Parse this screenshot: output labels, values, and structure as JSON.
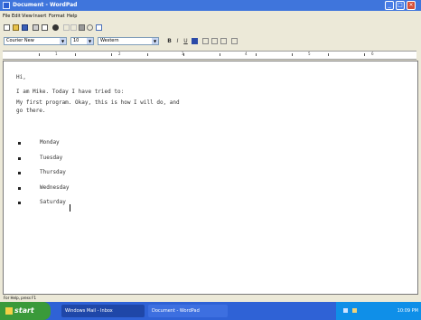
{
  "window": {
    "title": "Document - WordPad",
    "controls": {
      "minimize": "_",
      "maximize": "□",
      "close": "×"
    }
  },
  "menu": [
    "File",
    "Edit",
    "View",
    "Insert",
    "Format",
    "Help"
  ],
  "format_bar": {
    "font_name": "Courier New",
    "font_size": "10",
    "script": "Western",
    "bold": "B",
    "italic": "I",
    "underline": "U"
  },
  "ruler": [
    "1",
    "2",
    "3",
    "4",
    "5",
    "6"
  ],
  "document": {
    "lines": [
      "Hi,",
      "I am Mike. Today I have tried to:",
      "My first program. Okay, this is how I will do, and",
      "go there."
    ],
    "bullets": [
      "Monday",
      "Tuesday",
      "Thursday",
      "Wednesday",
      "Saturday"
    ]
  },
  "status": "For Help, press F1",
  "taskbar": {
    "start": "start",
    "tasks": [
      "Windows Mail - Inbox",
      "Document - WordPad"
    ],
    "clock": "10:09 PM"
  },
  "colors": {
    "titlebar": "#3f75dc",
    "taskbar": "#2f62d6",
    "start": "#3a9a3a",
    "tray": "#0f8fe8",
    "chrome": "#ece9d8"
  },
  "icons": [
    "app-icon",
    "new-icon",
    "open-icon",
    "save-icon",
    "print-icon",
    "print-preview-icon",
    "find-icon",
    "cut-icon",
    "copy-icon",
    "paste-icon",
    "undo-icon",
    "date-time-icon",
    "color-icon",
    "align-left-icon",
    "align-center-icon",
    "align-right-icon",
    "bullets-icon",
    "windows-flag-icon",
    "network-icon",
    "volume-icon"
  ]
}
